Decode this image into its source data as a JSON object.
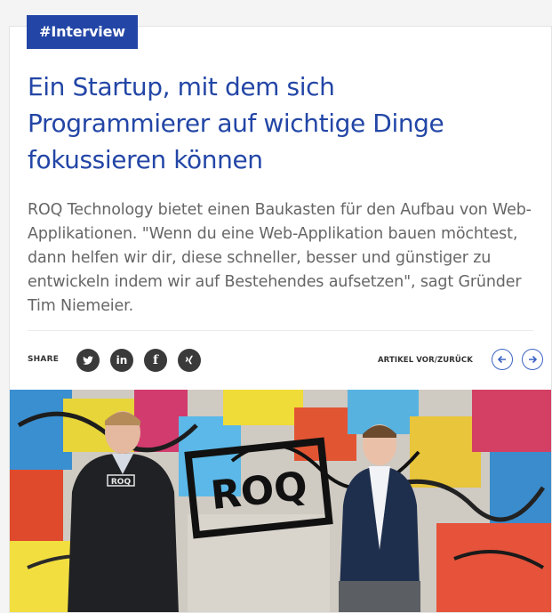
{
  "article": {
    "tag": "#Interview",
    "title_lines": [
      "Ein Startup, mit dem sich",
      "Programmierer auf wichtige Dinge",
      "fokussieren können"
    ],
    "lead": "ROQ Technology bietet einen Baukasten für den Aufbau von Web-Applikationen. \"Wenn du eine Web-Applikation bauen möchtest, dann helfen wir dir, diese schneller, besser und günstiger zu entwickeln indem wir auf Bestehendes aufsetzen\", sagt Gründer Tim Niemeier."
  },
  "share": {
    "label": "SHARE",
    "items": [
      {
        "icon": "twitter-icon",
        "glyph": ""
      },
      {
        "icon": "linkedin-icon",
        "glyph": "in"
      },
      {
        "icon": "facebook-icon",
        "glyph": "f"
      },
      {
        "icon": "xing-icon",
        "glyph": ""
      }
    ]
  },
  "nav": {
    "label": "ARTIKEL VOR/ZURÜCK",
    "prev": "arrow-left-icon",
    "next": "arrow-right-icon"
  },
  "photo": {
    "shirt_logo": "ROQ",
    "wall_logo": "ROQ"
  },
  "colors": {
    "accent": "#2346a6",
    "accent_light": "#3b63c4",
    "lead_text": "#666666",
    "icon_dark": "#3a3a3a"
  }
}
